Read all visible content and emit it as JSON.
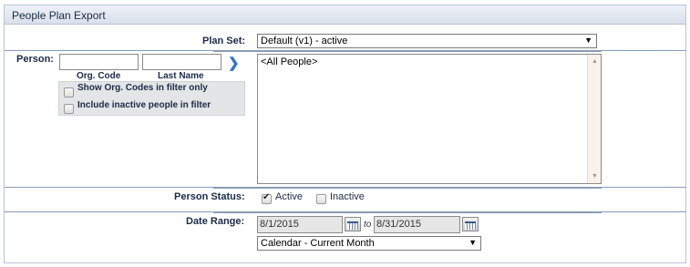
{
  "panel": {
    "title": "People Plan Export"
  },
  "plan_set": {
    "label": "Plan Set:",
    "value": "Default (v1) - active"
  },
  "person": {
    "label": "Person:",
    "org_code_label": "Org. Code",
    "last_name_label": "Last Name",
    "org_code_value": "",
    "last_name_value": "",
    "go_icon": "chevron-right-icon",
    "show_org_codes": {
      "label": "Show Org. Codes in filter only",
      "checked": false
    },
    "include_inactive": {
      "label": "Include inactive people in filter",
      "checked": false
    },
    "list_items": [
      "<All People>"
    ]
  },
  "person_status": {
    "label": "Person Status:",
    "active": {
      "label": "Active",
      "checked": true
    },
    "inactive": {
      "label": "Inactive",
      "checked": false
    }
  },
  "date_range": {
    "label": "Date Range:",
    "from": "8/1/2015",
    "to_label": "to",
    "to": "8/31/2015",
    "calendar_icon": "calendar-icon",
    "preset": "Calendar - Current Month"
  },
  "colors": {
    "header_bg": "#dfe5ee",
    "separator": "#8a9bb4",
    "label_text": "#1b2b4a",
    "go_arrow": "#2a77c9"
  }
}
